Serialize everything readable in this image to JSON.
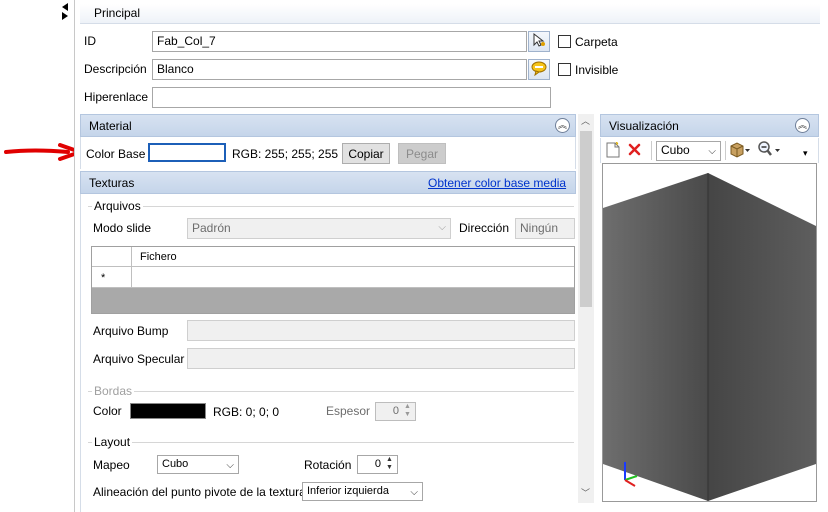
{
  "principal": {
    "title": "Principal",
    "id_label": "ID",
    "id_value": "Fab_Col_7",
    "carpeta_label": "Carpeta",
    "descripcion_label": "Descripción",
    "descripcion_value": "Blanco",
    "invisible_label": "Invisible",
    "hiperenlace_label": "Hiperenlace",
    "hiperenlace_value": ""
  },
  "material": {
    "title": "Material",
    "color_base_label": "Color Base",
    "color_base_hex": "#ffffff",
    "rgb_text": "RGB: 255; 255; 255",
    "copy_label": "Copiar",
    "paste_label": "Pegar"
  },
  "texturas": {
    "title": "Texturas",
    "link": "Obtener color base media",
    "arquivos_title": "Arquivos",
    "modo_slide_label": "Modo slide",
    "modo_slide_value": "Padrón",
    "direccion_label": "Dirección",
    "direccion_value": "Ningún",
    "grid_header": "Fichero",
    "grid_new_row_marker": "*",
    "bump_label": "Arquivo Bump",
    "specular_label": "Arquivo Specular"
  },
  "bordas": {
    "title": "Bordas",
    "color_label": "Color",
    "color_hex": "#000000",
    "rgb_text": "RGB: 0; 0; 0",
    "espesor_label": "Espesor",
    "espesor_value": "0"
  },
  "layout": {
    "title": "Layout",
    "mapeo_label": "Mapeo",
    "mapeo_value": "Cubo",
    "rotacion_label": "Rotación",
    "rotacion_value": "0",
    "pivot_label": "Alineación del punto pivote de la textura",
    "pivot_value": "Inferior izquierda"
  },
  "visualizacion": {
    "title": "Visualización",
    "shape_value": "Cubo"
  },
  "icons": {
    "collapse": "double-chevron-up-icon",
    "arrow": "red-arrow-annotation",
    "new": "new-document-icon",
    "delete": "red-x-icon",
    "package": "box-icon",
    "zoom": "magnifier-icon"
  }
}
